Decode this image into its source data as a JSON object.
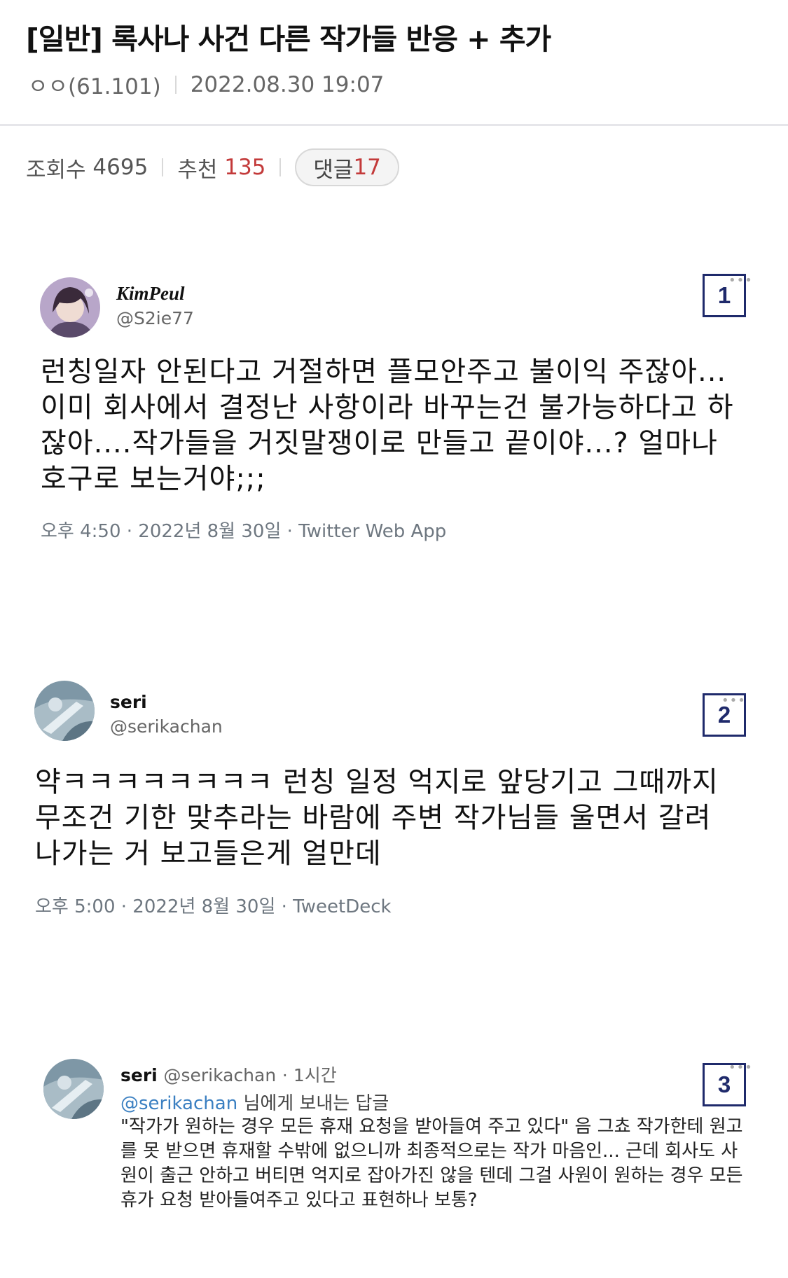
{
  "post": {
    "title": "[일반] 록사나 사건 다른 작가들 반응 + 추가",
    "author": "ㅇㅇ(61.101)",
    "date": "2022.08.30 19:07"
  },
  "stats": {
    "views_label": "조회수",
    "views": "4695",
    "recommend_label": "추천",
    "recommend": "135",
    "comments_label": "댓글",
    "comments": "17"
  },
  "tweets": [
    {
      "number": "1",
      "name": "KimPeul",
      "handle": "@S2ie77",
      "body": "런칭일자 안된다고 거절하면 플모안주고 불이익 주잖아...이미 회사에서 결정난 사항이라 바꾸는건 불가능하다고 하잖아....작가들을 거짓말쟁이로 만들고 끝이야...? 얼마나 호구로 보는거야;;;",
      "meta": "오후 4:50 · 2022년 8월 30일 · Twitter Web App"
    },
    {
      "number": "2",
      "name": "seri",
      "handle": "@serikachan",
      "body": "약ㅋㅋㅋㅋㅋㅋㅋㅋ 런칭 일정 억지로 앞당기고 그때까지 무조건 기한 맞추라는 바람에 주변 작가님들 울면서 갈려나가는 거 보고들은게 얼만데",
      "meta": "오후 5:00 · 2022년 8월 30일 · TweetDeck"
    },
    {
      "number": "3",
      "name": "seri",
      "handle": "@serikachan",
      "time": "· 1시간",
      "reply_to": "@serikachan",
      "reply_suffix": "님에게 보내는 답글",
      "body": "\"작가가 원하는 경우 모든 휴재 요청을 받아들여 주고 있다\" 음 그쵸 작가한테 원고를 못 받으면 휴재할 수밖에 없으니까 최종적으로는 작가 마음인... 근데 회사도 사원이 출근 안하고 버티면 억지로 잡아가진 않을 텐데 그걸 사원이 원하는 경우 모든 휴가 요청 받아들여주고 있다고 표현하나 보통?"
    }
  ],
  "icons": {
    "more": "more-icon",
    "avatar1": "avatar",
    "avatar2": "avatar"
  },
  "colors": {
    "accent_red": "#c33a3a",
    "number_box": "#1f2a6b",
    "link_blue": "#3a7fc1"
  }
}
